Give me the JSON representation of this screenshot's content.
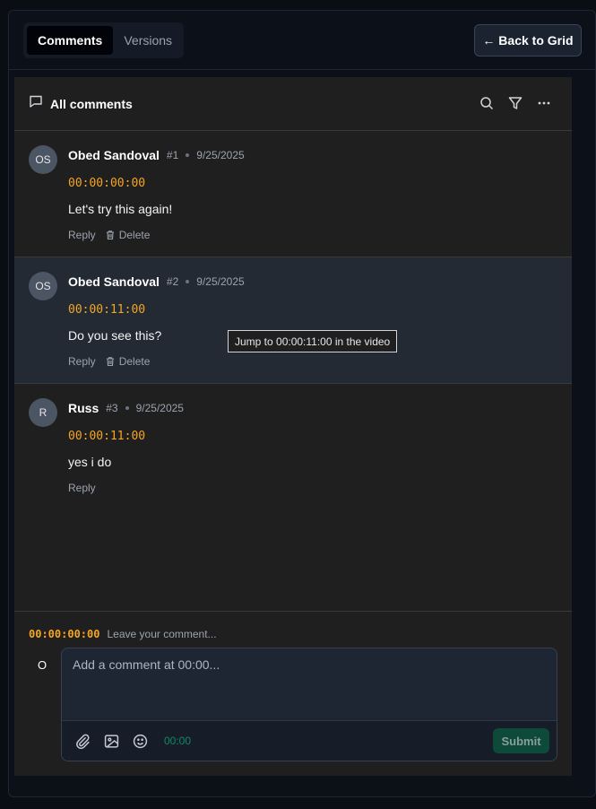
{
  "tabs": [
    {
      "label": "Comments",
      "active": true
    },
    {
      "label": "Versions",
      "active": false
    }
  ],
  "back_button": "← Back to Grid",
  "panel": {
    "title": "All comments",
    "header_icons": [
      "search-icon",
      "filter-icon",
      "more-icon"
    ]
  },
  "comments": [
    {
      "initials": "OS",
      "author": "Obed Sandoval",
      "number": "#1",
      "date": "9/25/2025",
      "timecode": "00:00:00:00",
      "text": "Let's try this again!",
      "reply": "Reply",
      "delete": "Delete"
    },
    {
      "initials": "OS",
      "author": "Obed Sandoval",
      "number": "#2",
      "date": "9/25/2025",
      "timecode": "00:00:11:00",
      "text": "Do you see this?",
      "reply": "Reply",
      "delete": "Delete"
    },
    {
      "initials": "R",
      "author": "Russ",
      "number": "#3",
      "date": "9/25/2025",
      "timecode": "00:00:11:00",
      "text": "yes i do",
      "reply": "Reply"
    }
  ],
  "tooltip": "Jump to 00:00:11:00 in the video",
  "composer": {
    "timecode": "00:00:00:00",
    "hint": "Leave your comment...",
    "initial": "O",
    "placeholder": "Add a comment at 00:00...",
    "toolbar_timecode": "00:00",
    "submit": "Submit"
  },
  "colors": {
    "timecode": "#f5a524",
    "submit_bg": "#0d4a3a",
    "highlight_row": "#232a34"
  }
}
